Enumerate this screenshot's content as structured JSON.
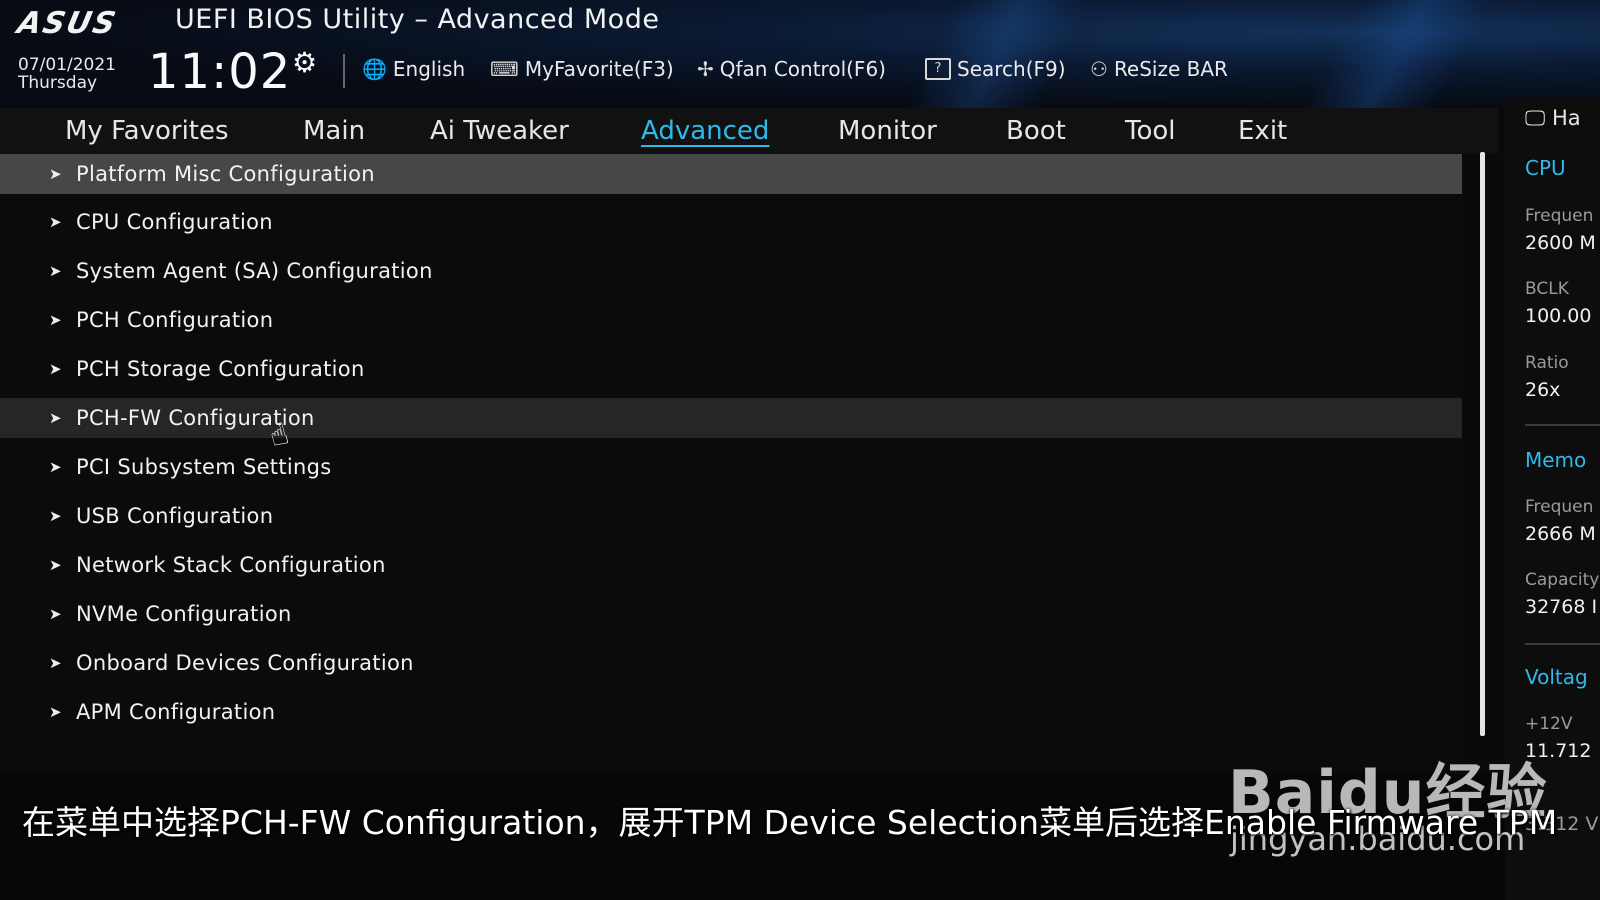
{
  "header": {
    "logo": "ASUS",
    "title": "UEFI BIOS Utility – Advanced Mode",
    "date": "07/01/2021",
    "day": "Thursday",
    "time": "11:02",
    "tools": [
      {
        "icon": "globe-icon",
        "glyph": "🌐",
        "label": "English"
      },
      {
        "icon": "keyboard-icon",
        "glyph": "⌨",
        "label": "MyFavorite(F3)"
      },
      {
        "icon": "fan-icon",
        "glyph": "✢",
        "label": "Qfan Control(F6)"
      },
      {
        "icon": "help-box-icon",
        "glyph": "?",
        "label": "Search(F9)"
      },
      {
        "icon": "resize-bar-icon",
        "glyph": "⚇",
        "label": "ReSize BAR"
      }
    ]
  },
  "tabs": [
    {
      "label": "My Favorites",
      "active": false
    },
    {
      "label": "Main",
      "active": false
    },
    {
      "label": "Ai Tweaker",
      "active": false
    },
    {
      "label": "Advanced",
      "active": true
    },
    {
      "label": "Monitor",
      "active": false
    },
    {
      "label": "Boot",
      "active": false
    },
    {
      "label": "Tool",
      "active": false
    },
    {
      "label": "Exit",
      "active": false
    }
  ],
  "menu": {
    "items": [
      {
        "label": "Platform Misc Configuration",
        "state": "selected"
      },
      {
        "label": "CPU Configuration",
        "state": ""
      },
      {
        "label": "System Agent (SA) Configuration",
        "state": ""
      },
      {
        "label": "PCH Configuration",
        "state": ""
      },
      {
        "label": "PCH Storage Configuration",
        "state": ""
      },
      {
        "label": "PCH-FW Configuration",
        "state": "hover"
      },
      {
        "label": "PCI Subsystem Settings",
        "state": ""
      },
      {
        "label": "USB Configuration",
        "state": ""
      },
      {
        "label": "Network Stack Configuration",
        "state": ""
      },
      {
        "label": "NVMe Configuration",
        "state": ""
      },
      {
        "label": "Onboard Devices Configuration",
        "state": ""
      },
      {
        "label": "APM Configuration",
        "state": ""
      }
    ]
  },
  "right_panel": {
    "header": "Ha",
    "cpu_section": "CPU",
    "frequency_label": "Frequen",
    "frequency_value": "2600 M",
    "bclk_label": "BCLK",
    "bclk_value": "100.00",
    "ratio_label": "Ratio",
    "ratio_value": "26x",
    "memory_section": "Memo",
    "mem_frequency_label": "Frequen",
    "mem_frequency_value": "2666 M",
    "capacity_label": "Capacity",
    "capacity_value": "32768 I",
    "voltage_section": "Voltag",
    "v12_label": "+12V",
    "v12_value": "11.712",
    "v33_value": "3.312 V"
  },
  "subtitle": "在菜单中选择PCH-FW Configuration，展开TPM Device Selection菜单后选择Enable Firmware TPM",
  "watermark": {
    "logo": "Baidu经验",
    "url": "jingyan.baidu.com"
  },
  "colors": {
    "accent": "#2fb8e8",
    "selected_row": "#474747",
    "hover_row": "#262626"
  }
}
